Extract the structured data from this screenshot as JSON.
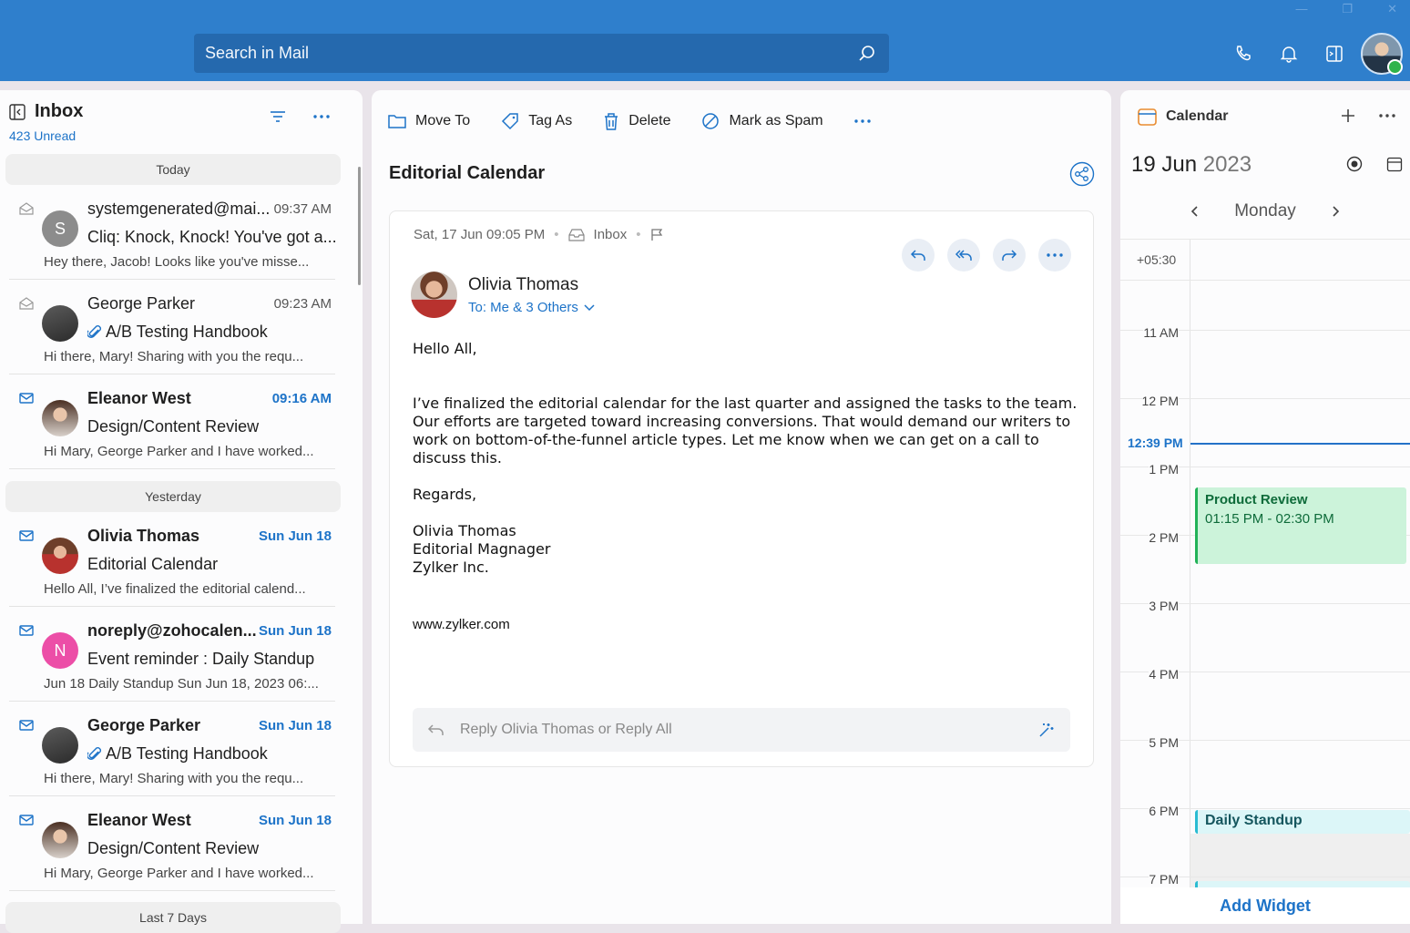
{
  "search": {
    "placeholder": "Search in Mail"
  },
  "inbox": {
    "title": "Inbox",
    "unread": "423 Unread"
  },
  "sections": [
    "Today",
    "Yesterday",
    "Last 7 Days"
  ],
  "mails": [
    {
      "from": "systemgenerated@mai...",
      "time": "09:37 AM",
      "subject": "Cliq: Knock, Knock! You've got a...",
      "preview": "Hey there, Jacob! Looks like you've misse...",
      "avatar": "S",
      "unread": false,
      "attachment": false
    },
    {
      "from": "George Parker",
      "time": "09:23 AM",
      "subject": "A/B Testing Handbook",
      "preview": "Hi there, Mary! Sharing with you the requ...",
      "avatar": "",
      "unread": false,
      "attachment": true
    },
    {
      "from": "Eleanor West",
      "time": "09:16 AM",
      "subject": "Design/Content Review",
      "preview": "Hi Mary, George Parker and I have worked...",
      "avatar": "",
      "unread": true,
      "attachment": false
    },
    {
      "from": "Olivia Thomas",
      "time": "Sun Jun 18",
      "subject": "Editorial Calendar",
      "preview": "Hello All, I’ve finalized the editorial calend...",
      "avatar": "",
      "unread": true,
      "attachment": false
    },
    {
      "from": "noreply@zohocalen...",
      "time": "Sun Jun 18",
      "subject": "Event reminder : Daily Standup",
      "preview": "Jun 18 Daily Standup Sun Jun 18, 2023 06:...",
      "avatar": "N",
      "unread": true,
      "attachment": false
    },
    {
      "from": "George Parker",
      "time": "Sun Jun 18",
      "subject": "A/B Testing Handbook",
      "preview": "Hi there, Mary! Sharing with you the requ...",
      "avatar": "",
      "unread": true,
      "attachment": true
    },
    {
      "from": "Eleanor West",
      "time": "Sun Jun 18",
      "subject": "Design/Content Review",
      "preview": "Hi Mary, George Parker and I have worked...",
      "avatar": "",
      "unread": true,
      "attachment": false
    }
  ],
  "toolbar": {
    "move": "Move To",
    "tag": "Tag As",
    "delete": "Delete",
    "spam": "Mark as Spam"
  },
  "message": {
    "subject": "Editorial Calendar",
    "date": "Sat, 17 Jun 09:05 PM",
    "folder": "Inbox",
    "sender": "Olivia Thomas",
    "to": "To: Me & 3 Others",
    "greeting": "Hello All,",
    "para": "I’ve finalized the editorial calendar for the last quarter and assigned the tasks to the team. Our efforts are targeted toward increasing conversions. That would demand our writers to work on bottom-of-the-funnel article types. Let me know when we can get on a call to discuss this.",
    "regards": "Regards,",
    "sig_name": "Olivia Thomas",
    "sig_title": "Editorial Magnager",
    "sig_company": "Zylker Inc.",
    "website": "www.zylker.com",
    "reply_placeholder": "Reply Olivia Thomas or Reply All"
  },
  "calendar": {
    "title": "Calendar",
    "day": "19 Jun",
    "year": "2023",
    "weekday": "Monday",
    "timezone": "+05:30",
    "hours": [
      "11 AM",
      "12 PM",
      "1 PM",
      "2 PM",
      "3 PM",
      "4 PM",
      "5 PM",
      "6 PM",
      "7 PM"
    ],
    "now": "12:39 PM",
    "events": [
      {
        "title": "Product Review",
        "range": "01:15 PM - 02:30 PM"
      },
      {
        "title": "Daily Standup"
      }
    ],
    "add_widget": "Add Widget"
  },
  "colors": {
    "brand": "#2f7fcc",
    "accent": "#1d73c8",
    "event_green": "#ccf3da",
    "event_teal": "#dcf6f8"
  }
}
